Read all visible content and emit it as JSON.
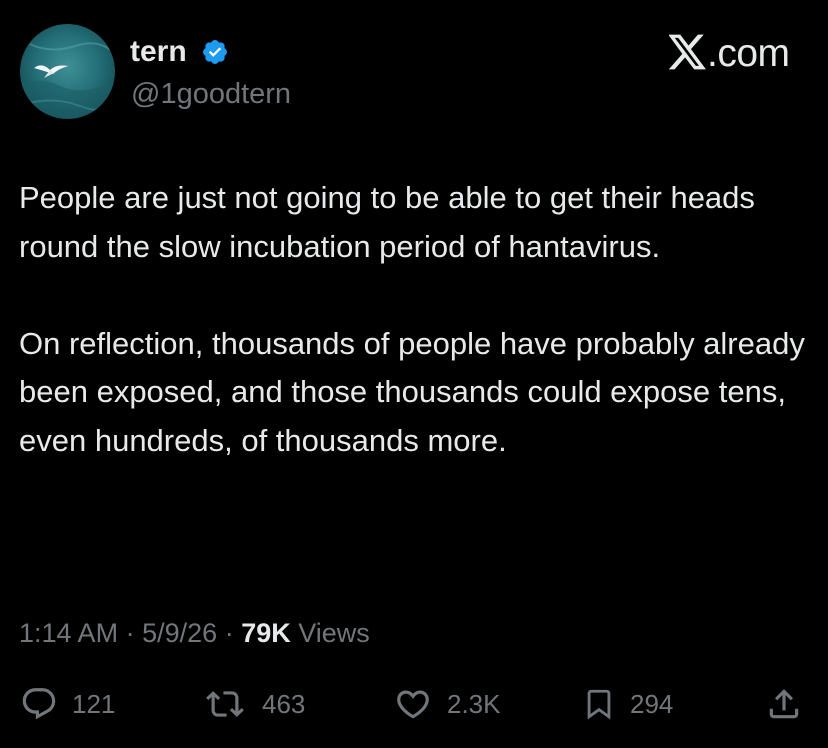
{
  "author": {
    "display_name": "tern",
    "handle": "@1goodtern",
    "verified": true,
    "avatar_icon": "seabird-over-water-avatar"
  },
  "brand": {
    "x_glyph": "𝕏",
    "domain_suffix": ".com"
  },
  "tweet": {
    "paragraphs": [
      "People are just not going to be able to get their heads round the slow incubation period of hantavirus.",
      "On reflection, thousands of people have probably already been exposed, and those thousands could expose tens, even hundreds, of thousands more."
    ]
  },
  "meta": {
    "time": "1:14 AM",
    "separator": "·",
    "date": "5/9/26",
    "views_count": "79K",
    "views_label": "Views"
  },
  "actions": {
    "replies": "121",
    "reposts": "463",
    "likes": "2.3K",
    "bookmarks": "294"
  },
  "colors": {
    "background": "#000000",
    "text_primary": "#e7e9ea",
    "text_secondary": "#71767b",
    "verified_blue": "#1d9bf0"
  }
}
